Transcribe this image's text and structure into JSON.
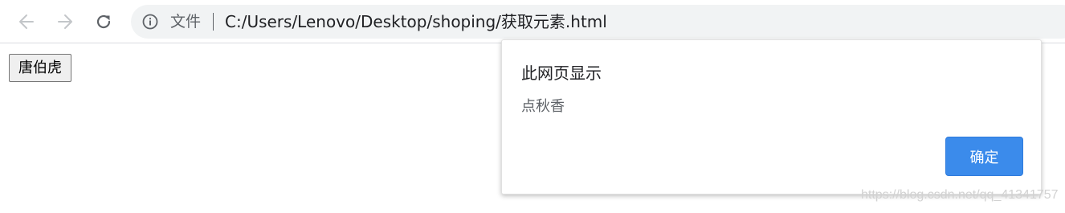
{
  "toolbar": {
    "icons": {
      "back": "arrow-left-icon",
      "forward": "arrow-right-icon",
      "reload": "reload-icon",
      "site_info": "info-icon"
    },
    "site_info_label": "文件",
    "url": "C:/Users/Lenovo/Desktop/shoping/获取元素.html"
  },
  "page": {
    "button_label": "唐伯虎"
  },
  "dialog": {
    "title": "此网页显示",
    "message": "点秋香",
    "ok_label": "确定",
    "accent_color": "#3b8beb"
  },
  "watermark": "https://blog.csdn.net/qq_41341757"
}
